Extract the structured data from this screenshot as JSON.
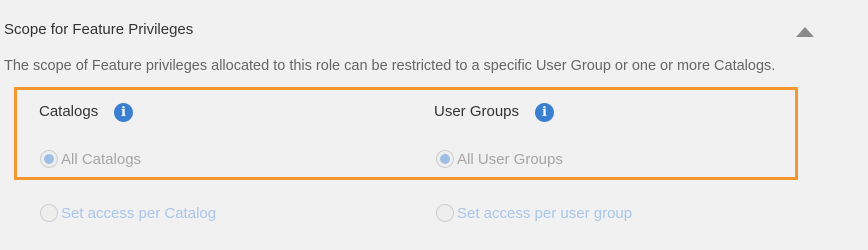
{
  "section": {
    "title": "Scope for Feature Privileges",
    "description": "The scope of Feature privileges allocated to this role can be restricted to a specific User Group or one or more Catalogs.",
    "collapse_icon": "triangle-up-icon"
  },
  "catalogs": {
    "label": "Catalogs",
    "info_icon": "i",
    "options": [
      {
        "label": "All Catalogs",
        "selected": true
      },
      {
        "label": "Set access per Catalog",
        "selected": false
      }
    ]
  },
  "user_groups": {
    "label": "User Groups",
    "info_icon": "i",
    "options": [
      {
        "label": "All User Groups",
        "selected": true
      },
      {
        "label": "Set access per user group",
        "selected": false
      }
    ]
  },
  "colors": {
    "highlight_border": "#f6962e",
    "info_icon_bg": "#3a7fd0",
    "disabled_text": "#a6a6a6",
    "link_text": "#a9c6eb"
  }
}
